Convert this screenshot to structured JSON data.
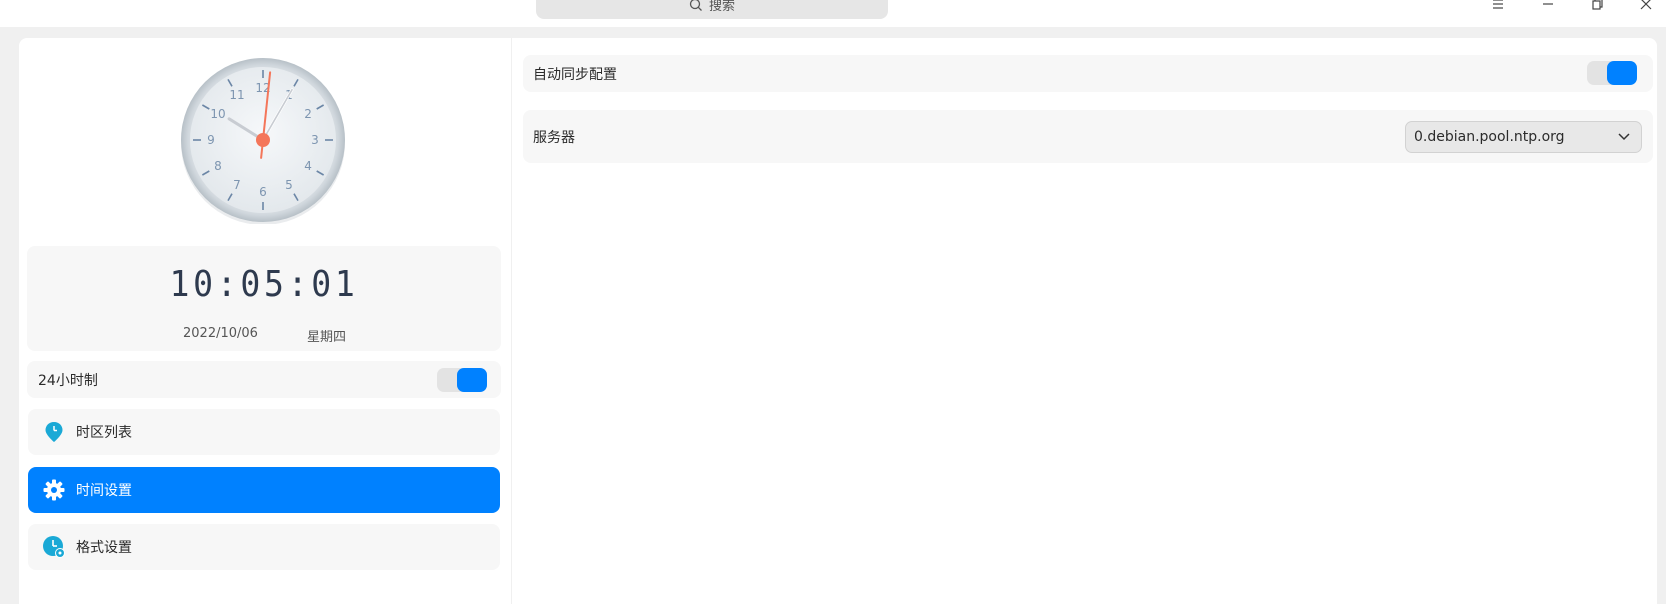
{
  "titlebar": {
    "search_label": "搜索"
  },
  "clock": {
    "numerals": [
      "12",
      "1",
      "2",
      "3",
      "4",
      "5",
      "6",
      "7",
      "8",
      "9",
      "10",
      "11"
    ],
    "hour_angle_deg": 302,
    "minute_angle_deg": 30,
    "second_angle_deg": 6,
    "hand_color": "#c8ccd2",
    "second_hand_color": "#f4765a"
  },
  "time_card": {
    "digital_time": "10:05:01",
    "date": "2022/10/06",
    "weekday": "星期四"
  },
  "settings": {
    "hour24_label": "24小时制",
    "hour24_enabled": true
  },
  "nav": {
    "items": [
      {
        "label": "时区列表",
        "icon": "timezone-pin-icon"
      },
      {
        "label": "时间设置",
        "icon": "gear-icon",
        "active": true
      },
      {
        "label": "格式设置",
        "icon": "format-clock-icon"
      }
    ]
  },
  "right": {
    "auto_sync_label": "自动同步配置",
    "auto_sync_enabled": true,
    "server_label": "服务器",
    "server_value": "0.debian.pool.ntp.org"
  },
  "colors": {
    "accent": "#0081ff",
    "icon_teal": "#1aa9d6"
  }
}
